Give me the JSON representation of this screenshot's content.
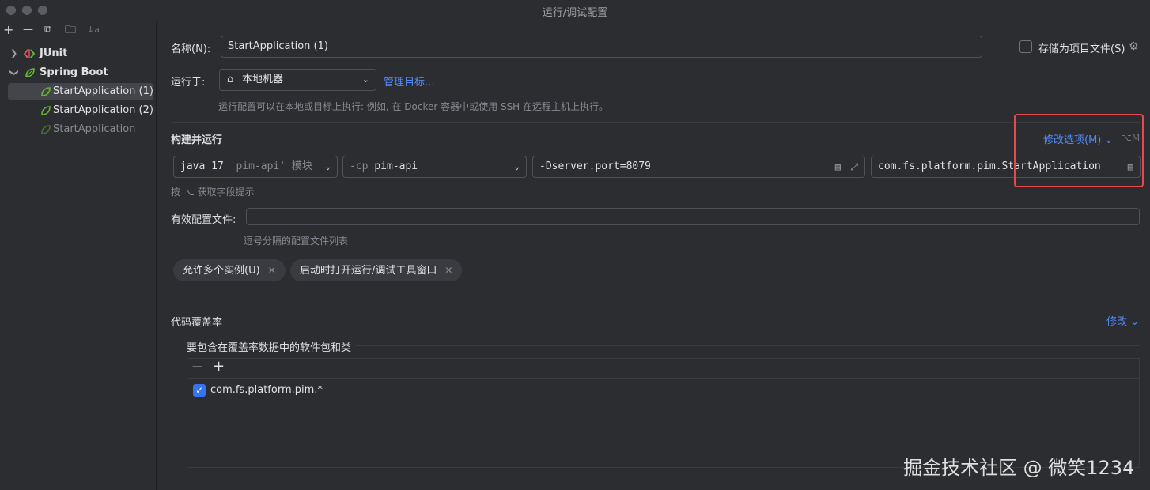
{
  "window": {
    "title": "运行/调试配置"
  },
  "toolbar": {
    "add": "+",
    "remove": "—",
    "copy": "⧉",
    "folder": "🗀",
    "sort": "↓a"
  },
  "tree": {
    "junit": "JUnit",
    "spring_boot": "Spring Boot",
    "items": [
      "StartApplication (1)",
      "StartApplication (2)",
      "StartApplication"
    ]
  },
  "form": {
    "name_label": "名称(N):",
    "name_value": "StartApplication (1)",
    "store_label": "存储为项目文件(S)",
    "run_on_label": "运行于:",
    "run_on_value": "本地机器",
    "manage_targets": "管理目标...",
    "run_on_hint": "运行配置可以在本地或目标上执行: 例如, 在 Docker 容器中或使用 SSH 在远程主机上执行。",
    "build_run_label": "构建并运行",
    "modify_options": "修改选项(M)",
    "modify_options_shortcut": "⌥M",
    "jdk": "java 17",
    "jdk_module": "'pim-api' 模块",
    "cp_prefix": "-cp",
    "cp_value": "pim-api",
    "vm_options": "-Dserver.port=8079",
    "main_class": "com.fs.platform.pim.StartApplication",
    "field_hint": "按 ⌥ 获取字段提示",
    "profiles_label": "有效配置文件:",
    "profiles_value": "",
    "profiles_hint": "逗号分隔的配置文件列表",
    "chips": [
      "允许多个实例(U)",
      "启动时打开运行/调试工具窗口"
    ]
  },
  "coverage": {
    "title": "代码覆盖率",
    "modify": "修改",
    "subtitle": "要包含在覆盖率数据中的软件包和类",
    "remove": "—",
    "add": "+",
    "items": [
      {
        "label": "com.fs.platform.pim.*",
        "checked": true
      }
    ]
  },
  "watermark": "掘金技术社区 @ 微笑1234",
  "colors": {
    "accent": "#548af7",
    "highlight_box": "#e5484d",
    "checkbox": "#3574f0",
    "spring": "#5fb832",
    "junit": "#e05555"
  }
}
